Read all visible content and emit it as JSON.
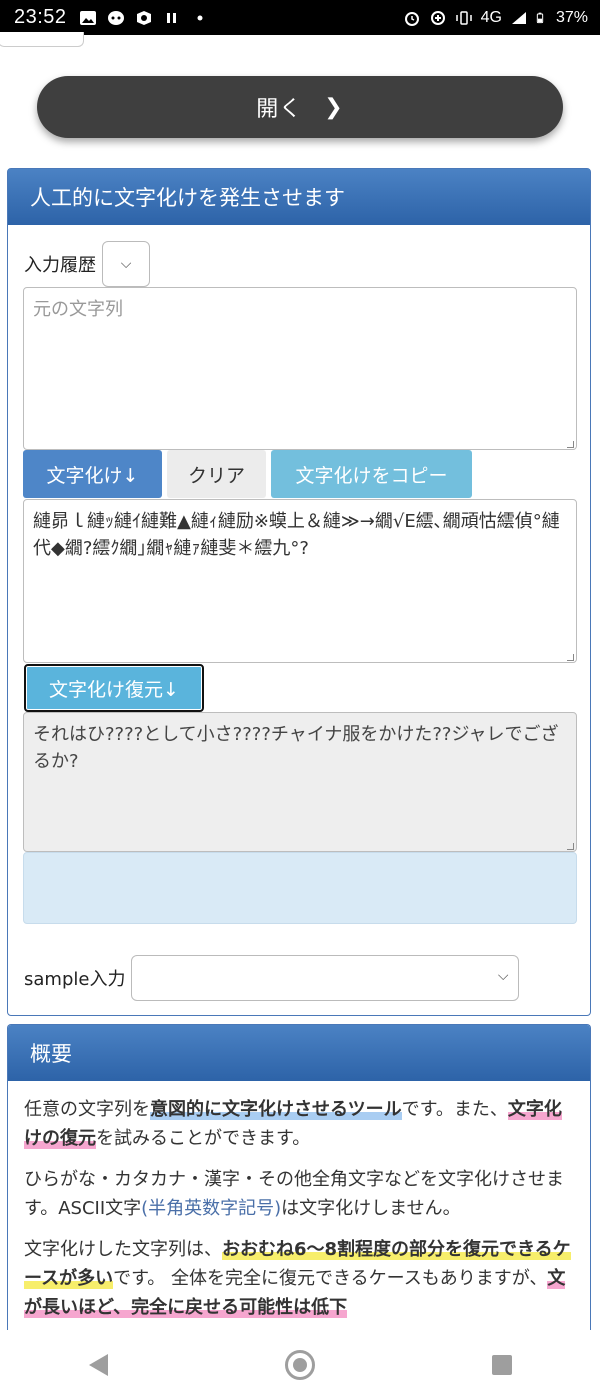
{
  "status_bar": {
    "time": "23:52",
    "network": "4G",
    "battery": "37%",
    "icons": [
      "image-icon",
      "app-icon",
      "app-icon",
      "pause-icon",
      "dot-icon",
      "alarm-icon",
      "data-saver-icon",
      "vibrate-icon",
      "signal-icon",
      "battery-icon"
    ]
  },
  "open_button": {
    "label": "開く",
    "icon": "chevron-right-icon"
  },
  "tool": {
    "title": "人工的に文字化けを発生させます",
    "history_label": "入力履歴",
    "input_placeholder": "元の文字列",
    "buttons": {
      "garble": "文字化け↓",
      "clear": "クリア",
      "copy": "文字化けをコピー",
      "restore": "文字化け復元↓"
    },
    "garbled_text": "縺昴ｌ縺ｯ縺ｲ縺難▲縺ｨ縺励※蟆上＆縺≫→繝√Ε繧､繝頑怙繧偵°縺代◆繝?繧ｸ繝｣繝ｬ縺ｧ縺斐＊繧九°?",
    "restored_text": "それはひ????として小さ????チャイナ服をかけた??ジャレでござるか?",
    "sample_label": "sample入力"
  },
  "overview": {
    "title": "概要",
    "p1": {
      "t1": "任意の文字列を",
      "h1": "意図的に文字化けさせるツール",
      "t2": "です。また、",
      "h2": "文字化けの復元",
      "t3": "を試みることができます。"
    },
    "p2": {
      "t1": "ひらがな・カタカナ・漢字・その他全角文字などを文字化けさせます。ASCII文字",
      "note": "(半角英数字記号)",
      "t2": "は文字化けしません。"
    },
    "p3": {
      "t1": "文字化けした文字列は、",
      "h1": "おおむね6〜8割程度の部分を復元できるケースが多い",
      "t2": "です。 全体を完全に復元できるケースもありますが、",
      "h2": "文が長いほど、完全に戻せる可能性は低下"
    }
  },
  "colors": {
    "header_blue": "#2d63a8",
    "button_blue": "#4e86c8",
    "button_cyan": "#73bfdd",
    "open_button": "#3f3f3f"
  }
}
